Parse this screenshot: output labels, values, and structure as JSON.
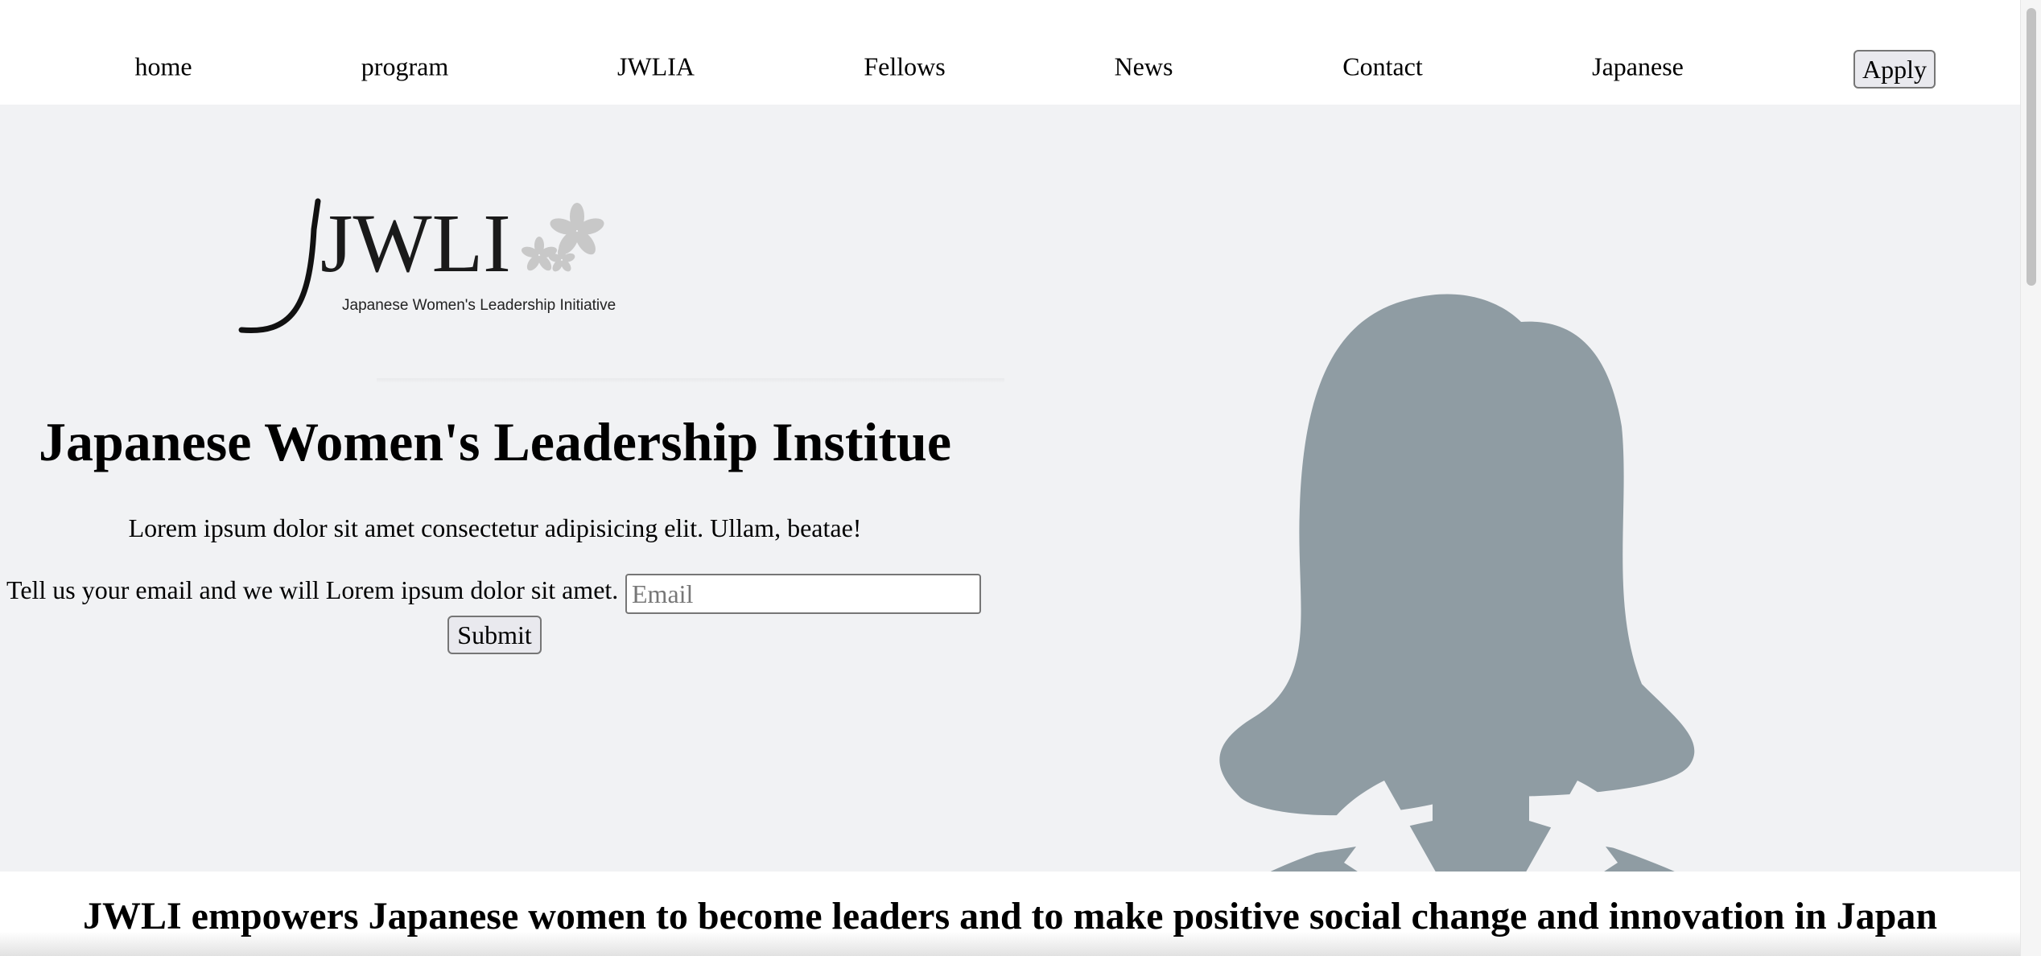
{
  "nav": {
    "items": [
      {
        "label": "home"
      },
      {
        "label": "program"
      },
      {
        "label": "JWLIA"
      },
      {
        "label": "Fellows"
      },
      {
        "label": "News"
      },
      {
        "label": "Contact"
      },
      {
        "label": "Japanese"
      }
    ],
    "apply_label": "Apply"
  },
  "logo": {
    "text": "JWLI",
    "subtitle": "Japanese Women's Leadership Initiative",
    "icon": "cherry-blossom-icon"
  },
  "hero": {
    "title": "Japanese Women's Leadership Institue",
    "subtitle": "Lorem ipsum dolor sit amet consectetur adipisicing elit. Ullam, beatae!",
    "email_prompt": "Tell us your email and we will Lorem ipsum dolor sit amet.",
    "email_placeholder": "Email",
    "email_value": "",
    "submit_label": "Submit",
    "image": "woman-silhouette-icon"
  },
  "mission": {
    "text": "JWLI empowers Japanese women to become leaders and to make positive social change and innovation in Japan"
  },
  "colors": {
    "hero_background": "#f1f2f4",
    "silhouette": "#8f9ca3",
    "page_background": "#ffffff"
  }
}
